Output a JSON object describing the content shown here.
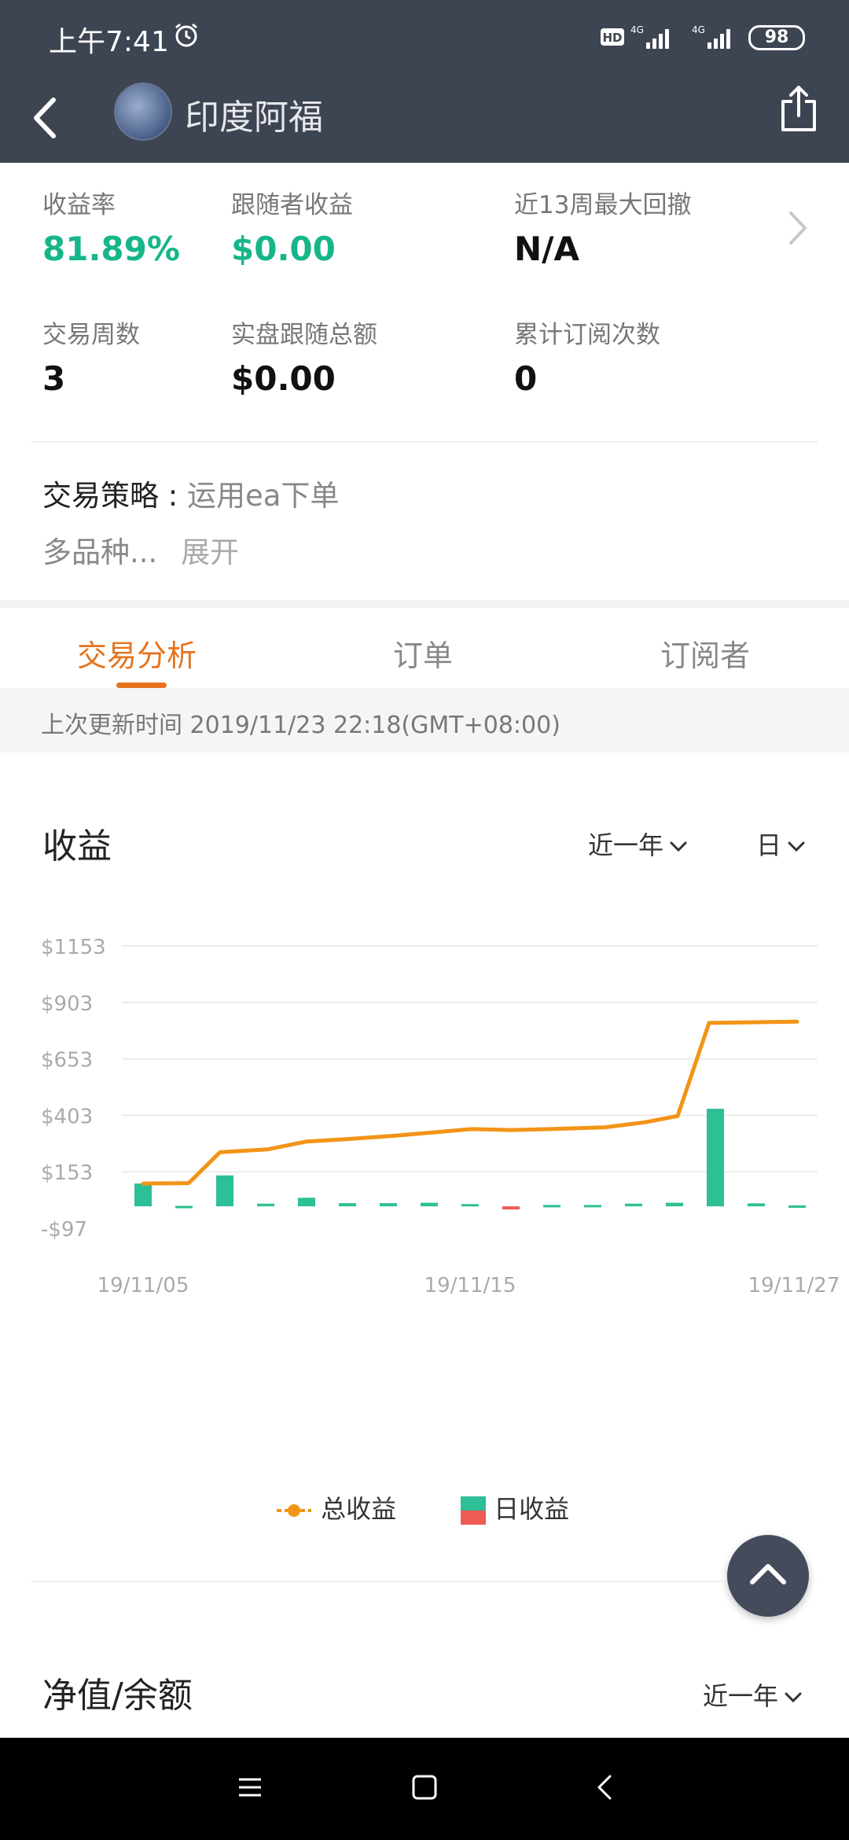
{
  "status_bar": {
    "time": "上午7:41",
    "battery": "98",
    "icons": [
      "alarm-icon",
      "hd-icon",
      "signal-4g-icon",
      "signal-4g-icon",
      "battery-icon"
    ]
  },
  "header": {
    "title": "印度阿福",
    "back_icon": "chevron-left-icon",
    "share_icon": "share-icon"
  },
  "stats": [
    {
      "label": "收益率",
      "value": "81.89%"
    },
    {
      "label": "跟随者收益",
      "value": "$0.00"
    },
    {
      "label": "近13周最大回撤",
      "value": "N/A"
    },
    {
      "label": "交易周数",
      "value": "3"
    },
    {
      "label": "实盘跟随总额",
      "value": "$0.00"
    },
    {
      "label": "累计订阅次数",
      "value": "0"
    }
  ],
  "strategy": {
    "label": "交易策略 :",
    "value": "运用ea下单",
    "more_text": "多品种...",
    "expand_label": "展开"
  },
  "tabs": [
    {
      "label": "交易分析",
      "active": true
    },
    {
      "label": "订单",
      "active": false
    },
    {
      "label": "订阅者",
      "active": false
    }
  ],
  "update_time": "上次更新时间 2019/11/23 22:18(GMT+08:00)",
  "earnings_section": {
    "title": "收益",
    "period_dropdown": "近一年",
    "granularity_dropdown": "日"
  },
  "chart_data": {
    "type": "bar+line",
    "y_ticks": [
      "$1153",
      "$903",
      "$653",
      "$403",
      "$153",
      "-$97"
    ],
    "ylim": [
      -97,
      1153
    ],
    "x_ticks": [
      "19/11/05",
      "19/11/15",
      "19/11/27"
    ],
    "series": [
      {
        "name": "总收益",
        "type": "line",
        "color": "#f29417",
        "values": [
          101,
          103,
          240,
          252,
          287,
          297,
          312,
          330,
          342,
          338,
          342,
          350,
          372,
          400,
          812,
          818
        ]
      },
      {
        "name": "日收益",
        "type": "bar",
        "colors": {
          "positive": "#2dbf95",
          "negative": "#ee5b54"
        },
        "values": [
          101,
          2,
          137,
          12,
          38,
          14,
          14,
          16,
          10,
          -14,
          6,
          6,
          12,
          16,
          432,
          13,
          4
        ]
      }
    ],
    "legend_position": "bottom"
  },
  "net_section": {
    "title": "净值/余额",
    "period_dropdown": "近一年"
  },
  "sys_nav_icons": [
    "menu-icon",
    "home-square-icon",
    "back-triangle-icon"
  ]
}
